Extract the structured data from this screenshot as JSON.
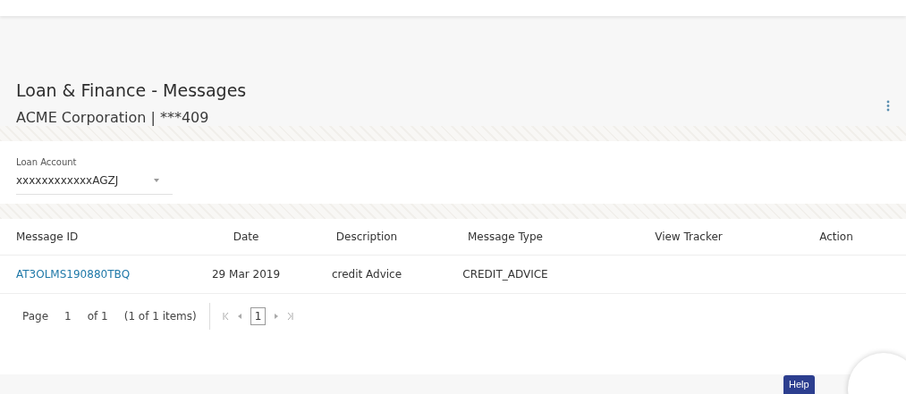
{
  "header": {
    "title": "Loan & Finance - Messages",
    "subtitle": "ACME Corporation | ***409"
  },
  "loan_account": {
    "label": "Loan Account",
    "value": "xxxxxxxxxxxxAGZJ"
  },
  "table": {
    "columns": [
      "Message ID",
      "Date",
      "Description",
      "Message Type",
      "View Tracker",
      "Action"
    ],
    "rows": [
      {
        "message_id": "AT3OLMS190880TBQ",
        "date": "29 Mar 2019",
        "description": "credit Advice",
        "message_type": "CREDIT_ADVICE"
      }
    ]
  },
  "pagination": {
    "page_label": "Page",
    "page": "1",
    "of": "of 1",
    "summary": "(1 of 1 items)",
    "pages": [
      {
        "label": "1",
        "selected": true
      }
    ]
  },
  "help": {
    "label": "Help"
  }
}
